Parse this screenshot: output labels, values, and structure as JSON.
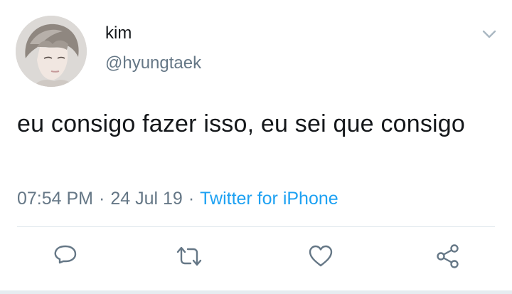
{
  "user": {
    "display_name": "kim",
    "handle": "@hyungtaek",
    "avatar_icon": "profile-photo"
  },
  "tweet": {
    "text": "eu consigo fazer isso, eu sei que consigo",
    "time": "07:54 PM",
    "date": "24 Jul 19",
    "separator": "·",
    "source": "Twitter for iPhone"
  },
  "actions": {
    "reply_icon": "reply-icon",
    "retweet_icon": "retweet-icon",
    "like_icon": "heart-icon",
    "share_icon": "share-icon"
  },
  "colors": {
    "text": "#14171a",
    "secondary": "#657786",
    "link": "#1da1f2",
    "icon": "#657786",
    "divider": "#e1e8ed"
  }
}
